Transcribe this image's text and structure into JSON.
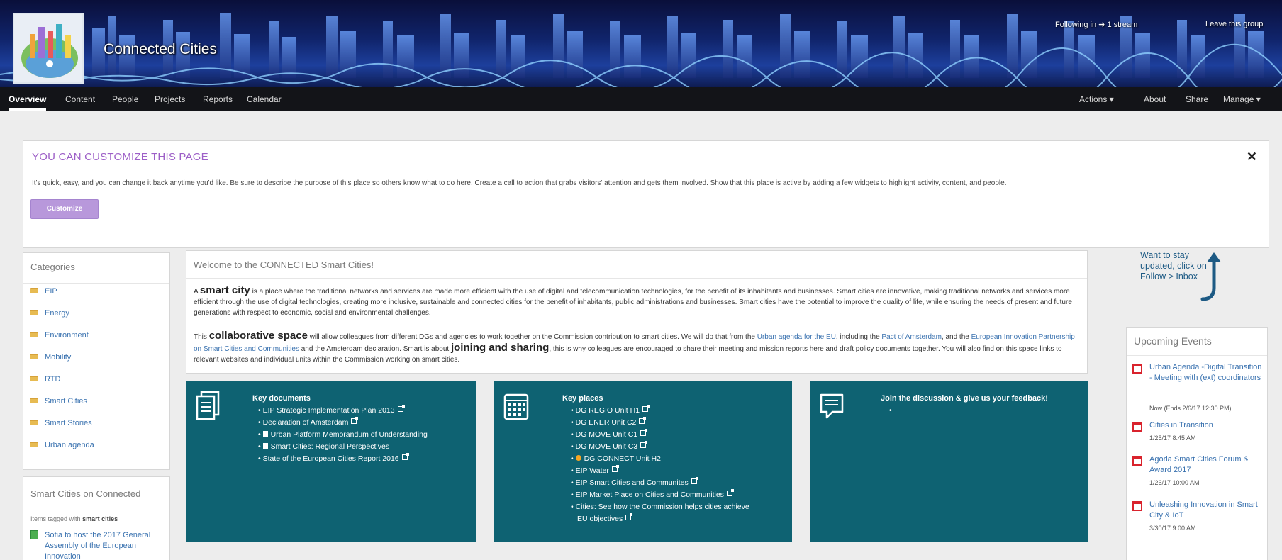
{
  "banner": {
    "group_title": "Connected Cities",
    "follow_text": "Following in",
    "follow_streams": "1 stream",
    "leave_label": "Leave this group"
  },
  "nav": {
    "tabs": [
      "Overview",
      "Content",
      "People",
      "Projects",
      "Reports",
      "Calendar"
    ],
    "right": [
      "Actions ▾",
      "About",
      "Share",
      "Manage ▾"
    ]
  },
  "customize": {
    "title": "YOU CAN CUSTOMIZE THIS PAGE",
    "close": "✕",
    "description": "It's quick, easy, and you can change it back anytime you'd like. Be sure to describe the purpose of this place so others know what to do here. Create a call to action that grabs visitors' attention and gets them involved. Show that this place is active by adding a few widgets to highlight activity, content, and people.",
    "button": "Customize"
  },
  "categories": {
    "title": "Categories",
    "items": [
      "EIP",
      "Energy",
      "Environment",
      "Mobility",
      "RTD",
      "Smart Cities",
      "Smart Stories",
      "Urban agenda"
    ]
  },
  "smart_cities": {
    "title": "Smart Cities on Connected",
    "tagged_prefix": "Items tagged with",
    "tagged_tag": "smart cities",
    "item": "Sofia to host the 2017 General Assembly of the European Innovation"
  },
  "welcome": {
    "title": "Welcome to the CONNECTED Smart Cities!",
    "p1_start": "A",
    "p1_big": "smart city",
    "p1_rest": "is a place where the traditional networks and services are made more efficient with the use of digital and telecommunication technologies, for the benefit of its inhabitants and businesses. Smart cities are innovative, making traditional networks and services more efficient through the use of digital technologies, creating more inclusive, sustainable and connected cities for the benefit of inhabitants, public administrations and businesses. Smart cities have the potential to improve the quality of life, while ensuring the needs of present and future generations with respect to economic, social and environmental challenges.",
    "p2_start": "This",
    "p2_big1": "collaborative space",
    "p2_a": "will allow colleagues from different DGs and agencies to work together on the Commission contribution to smart cities. We will do that from the",
    "p2_link1": "Urban agenda for the EU",
    "p2_b": ", including the",
    "p2_link2": "Pact of Amsterdam",
    "p2_c": ", and the",
    "p2_link3": "European Innovation Partnership on Smart Cities and Communities",
    "p2_d": "and the Amsterdam declaration. Smart is about",
    "p2_big2": "joining and sharing",
    "p2_e": ", this is why colleagues are encouraged to share their meeting and mission reports here and draft policy documents together. You will also find on this space links to relevant websites and individual units within the Commission working on smart cities."
  },
  "key_documents": {
    "title": "Key documents",
    "items": [
      "EIP Strategic Implementation Plan 2013",
      "Declaration of Amsterdam",
      "Urban Platform Memorandum of Understanding",
      "Smart Cities: Regional Perspectives",
      "State of the European Cities Report 2016"
    ]
  },
  "key_places": {
    "title": "Key places",
    "items": [
      "DG REGIO Unit H1",
      "DG ENER Unit C2",
      "DG MOVE Unit C1",
      "DG MOVE Unit C3",
      "DG CONNECT Unit H2",
      "EIP Water",
      "EIP Smart Cities and Communites",
      "EIP Market Place on Cities and Communities",
      "Cities: See how the Commission helps cities achieve",
      "EU objectives"
    ]
  },
  "discussion": {
    "title": "Join the discussion & give us your feedback!"
  },
  "follow_hint": "Want to stay updated, click on Follow > Inbox",
  "events": {
    "title": "Upcoming Events",
    "items": [
      {
        "name": "Urban Agenda -Digital Transition - Meeting with (ext) coordinators",
        "date": "Now (Ends 2/6/17 12:30 PM)"
      },
      {
        "name": "Cities in Transition",
        "date": "1/25/17 8:45 AM"
      },
      {
        "name": "Agoria Smart Cities Forum & Award 2017",
        "date": "1/26/17 10:00 AM"
      },
      {
        "name": "Unleashing Innovation in Smart City & IoT",
        "date": "3/30/17 9:00 AM"
      }
    ]
  },
  "colors": {
    "nav_bg": "#131418",
    "customize_title": "#9d5fc7",
    "customize_button": "#b898db",
    "teal_box": "#0e6272",
    "link": "#3b73b0",
    "event_icon": "#d9232d"
  }
}
